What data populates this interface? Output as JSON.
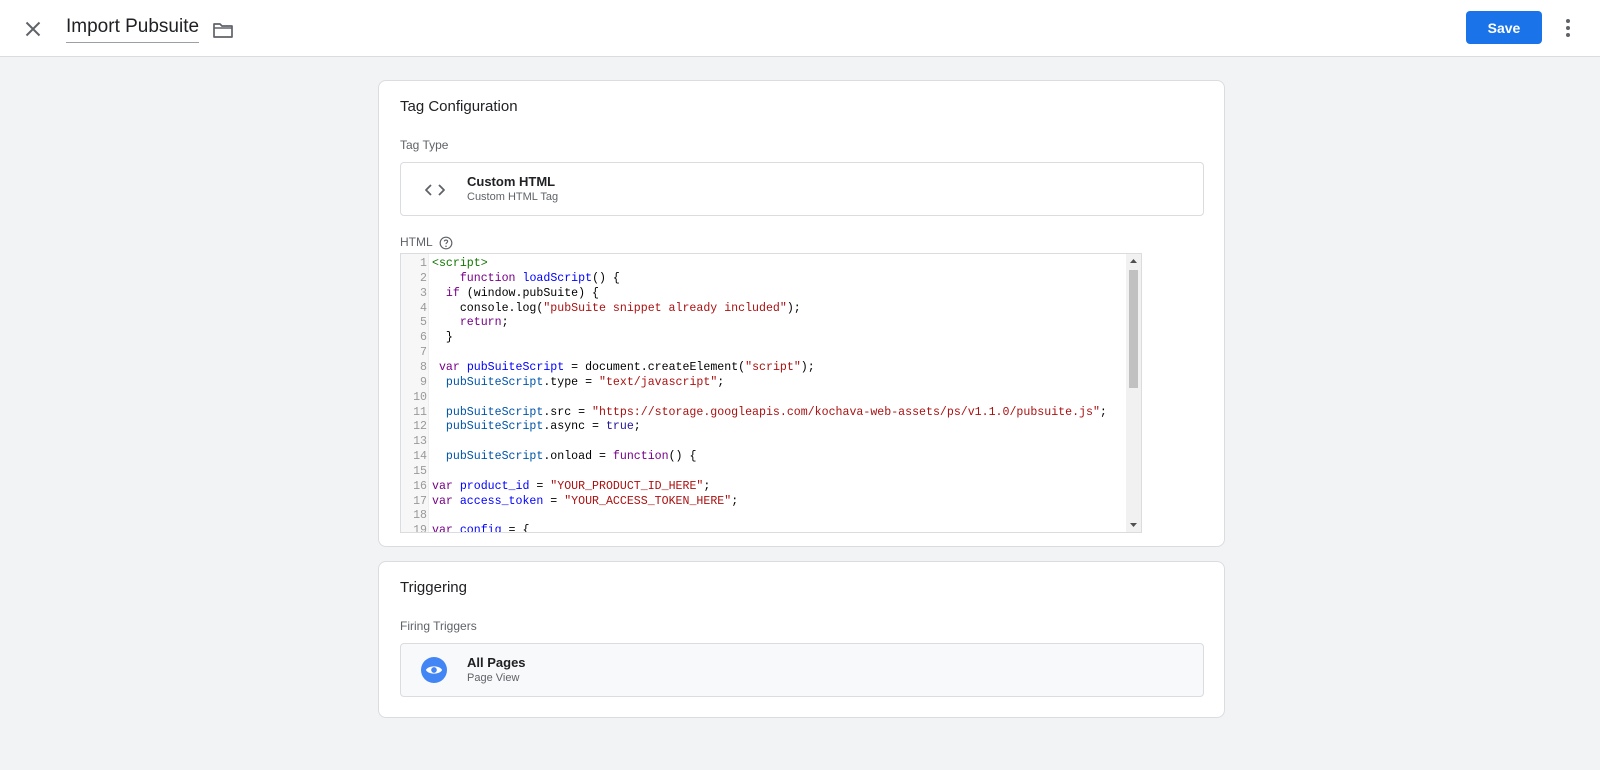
{
  "header": {
    "title": "Import Pubsuite",
    "save_label": "Save",
    "icons": {
      "close": "close-icon",
      "folder": "folder-icon",
      "more": "more-vert-icon"
    },
    "accent_color": "#1a73e8"
  },
  "tag_config": {
    "title": "Tag Configuration",
    "tag_type_label": "Tag Type",
    "tag_type_name": "Custom HTML",
    "tag_type_desc": "Custom HTML Tag",
    "html_label": "HTML",
    "code_lines": [
      "<script>",
      "    function loadScript() {",
      "  if (window.pubSuite) {",
      "    console.log(\"pubSuite snippet already included\");",
      "    return;",
      "  }",
      "",
      " var pubSuiteScript = document.createElement(\"script\");",
      "  pubSuiteScript.type = \"text/javascript\";",
      "",
      "  pubSuiteScript.src = \"https://storage.googleapis.com/kochava-web-assets/ps/v1.1.0/pubsuite.js\";",
      "  pubSuiteScript.async = true;",
      "",
      "  pubSuiteScript.onload = function() {",
      "",
      "var product_id = \"YOUR_PRODUCT_ID_HERE\";",
      "var access_token = \"YOUR_ACCESS_TOKEN_HERE\";",
      "",
      "var config = {"
    ]
  },
  "triggering": {
    "title": "Triggering",
    "firing_label": "Firing Triggers",
    "trigger_name": "All Pages",
    "trigger_desc": "Page View",
    "trigger_icon_color": "#4285f4"
  }
}
